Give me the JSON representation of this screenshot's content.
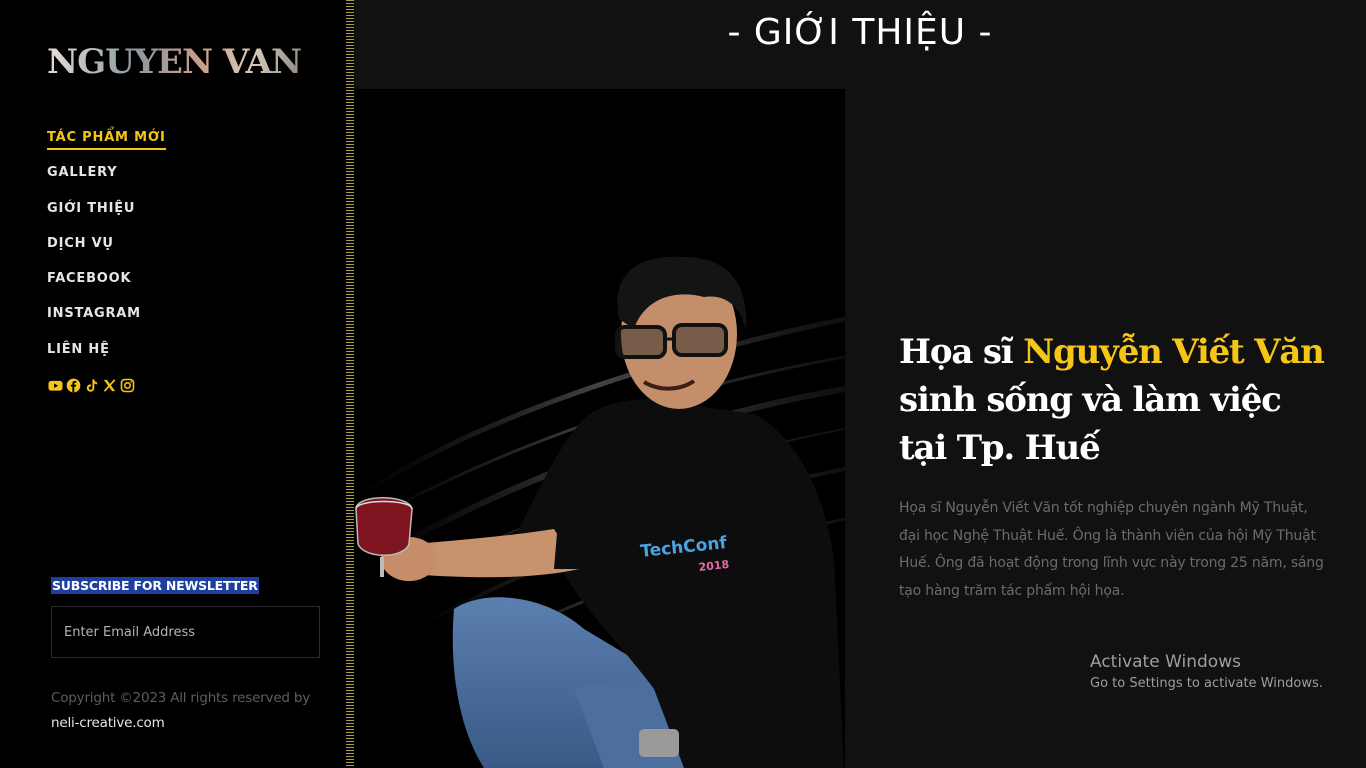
{
  "brand": {
    "logo_text": "NGUYEN VAN"
  },
  "nav": {
    "items": [
      {
        "label": "TÁC PHẨM MỚI",
        "active": true
      },
      {
        "label": "GALLERY"
      },
      {
        "label": "GIỚI THIỆU"
      },
      {
        "label": "DỊCH VỤ"
      },
      {
        "label": "FACEBOOK"
      },
      {
        "label": "INSTAGRAM"
      },
      {
        "label": "LIÊN HỆ"
      }
    ]
  },
  "socials": [
    "youtube-icon",
    "facebook-icon",
    "tiktok-icon",
    "x-icon",
    "instagram-icon"
  ],
  "newsletter": {
    "title": "SUBSCRIBE FOR NEWSLETTER",
    "placeholder": "Enter Email Address"
  },
  "footer": {
    "copyright": "Copyright ©2023 All rights reserved by",
    "link": "neli-creative.com"
  },
  "section": {
    "heading": "- GIỚI THIỆU -"
  },
  "intro": {
    "heading_prefix": "Họa sĩ ",
    "heading_name": "Nguyễn Viết Văn",
    "heading_line2": "sinh sống và làm việc",
    "heading_line3": "tại Tp. Huế",
    "body": "Họa sĩ Nguyễn Viết Văn tốt nghiệp chuyên ngành Mỹ Thuật, đại học Nghệ Thuật Huế. Ông là thành viên của hội Mỹ Thuật Huế. Ông đã hoạt động trong lĩnh vực này trong 25 năm, sáng tạo hàng trăm tác phẩm hội họa."
  },
  "photo": {
    "shirt_text_1": "TechConf",
    "shirt_text_2": "2018"
  },
  "watermark": {
    "line1": "Activate Windows",
    "line2": "Go to Settings to activate Windows."
  },
  "colors": {
    "accent": "#f5c518",
    "background": "#111111",
    "sidebar": "#000000"
  }
}
